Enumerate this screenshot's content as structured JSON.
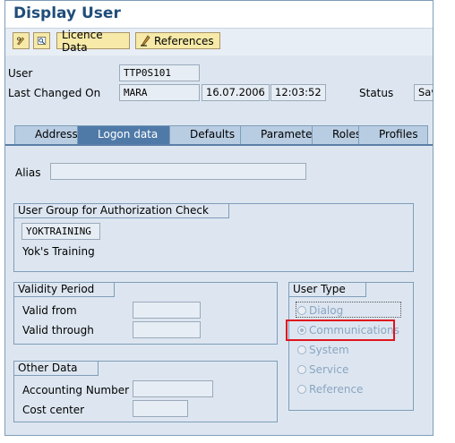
{
  "title": "Display User",
  "toolbar": {
    "licence_label": "Licence Data",
    "references_label": "References"
  },
  "header": {
    "user_label": "User",
    "user_value": "TTP0S101",
    "last_changed_label": "Last Changed On",
    "changed_by": "MARA",
    "changed_date": "16.07.2006",
    "changed_time": "12:03:52",
    "status_label": "Status",
    "status_value": "Sav"
  },
  "tabs": [
    "Address",
    "Logon data",
    "Defaults",
    "Parameters",
    "Roles",
    "Profiles"
  ],
  "active_tab": "Logon data",
  "alias": {
    "label": "Alias",
    "value": ""
  },
  "user_group": {
    "title": "User Group for Authorization Check",
    "value": "YOKTRAINING",
    "description": "Yok's Training"
  },
  "validity": {
    "title": "Validity Period",
    "valid_from_label": "Valid from",
    "valid_from": "",
    "valid_through_label": "Valid through",
    "valid_through": ""
  },
  "other": {
    "title": "Other Data",
    "accounting_label": "Accounting Number",
    "accounting_value": "",
    "cost_center_label": "Cost center",
    "cost_center_value": ""
  },
  "user_type": {
    "title": "User Type",
    "options": [
      "Dialog",
      "Communications",
      "System",
      "Service",
      "Reference"
    ],
    "selected": "Communications"
  },
  "colors": {
    "title": "#1f4d7a",
    "active_tab": "#4f7aa8",
    "highlight": "#e0141e",
    "button": "#f7eaa8"
  }
}
